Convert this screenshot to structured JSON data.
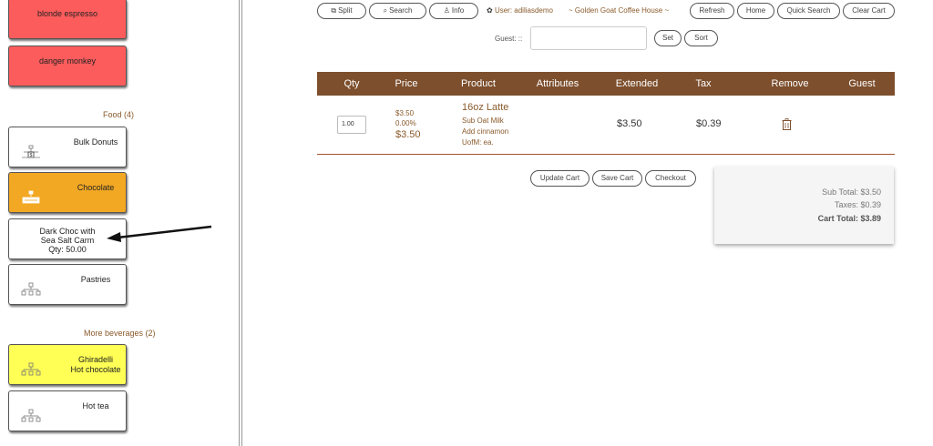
{
  "sidebar": {
    "tiles_top": [
      {
        "label": "blonde espresso"
      },
      {
        "label": "danger monkey"
      }
    ],
    "food_section": {
      "title": "Food (4)",
      "items": [
        {
          "label": "Bulk Donuts"
        },
        {
          "label": "Chocolate"
        },
        {
          "label_lines": [
            "Dark Choc with",
            "Sea Salt Carm",
            "Qty: 50.00"
          ]
        },
        {
          "label": "Pastries"
        }
      ]
    },
    "beverages_section": {
      "title": "More beverages (2)",
      "items": [
        {
          "label_lines": [
            "Ghiradelli",
            "Hot chocolate"
          ]
        },
        {
          "label": "Hot tea"
        }
      ]
    }
  },
  "toolbar": {
    "split": "Split",
    "search": "Search",
    "info": "Info",
    "user": "User: adiliasdemo",
    "store": "~ Golden Goat Coffee House ~",
    "refresh": "Refresh",
    "home": "Home",
    "quick_search": "Quick Search",
    "clear_cart": "Clear Cart",
    "guest_label": "Guest: ::",
    "guest_value": "",
    "set": "Set",
    "sort": "Sort"
  },
  "cart": {
    "columns": [
      "Qty",
      "Price",
      "Product",
      "Attributes",
      "Extended",
      "Tax",
      "Remove",
      "Guest"
    ],
    "rows": [
      {
        "qty": "1.00",
        "price_small": "$3.50",
        "discount": "0.00%",
        "price_big": "$3.50",
        "product": "16oz Latte",
        "attributes": [
          "Sub Oat Milk",
          "Add cinnamon",
          "UofM: ea."
        ],
        "extended": "$3.50",
        "tax": "$0.39"
      }
    ],
    "actions": {
      "update": "Update Cart",
      "save": "Save Cart",
      "checkout": "Checkout"
    },
    "totals": {
      "subtotal": "Sub Total: $3.50",
      "taxes": "Taxes: $0.39",
      "total": "Cart Total: $3.89"
    }
  },
  "colors": {
    "accent_brown": "#7d4f2d",
    "tile_red": "#fc5c5c",
    "tile_orange": "#f2a823",
    "tile_yellow": "#ffff55"
  }
}
